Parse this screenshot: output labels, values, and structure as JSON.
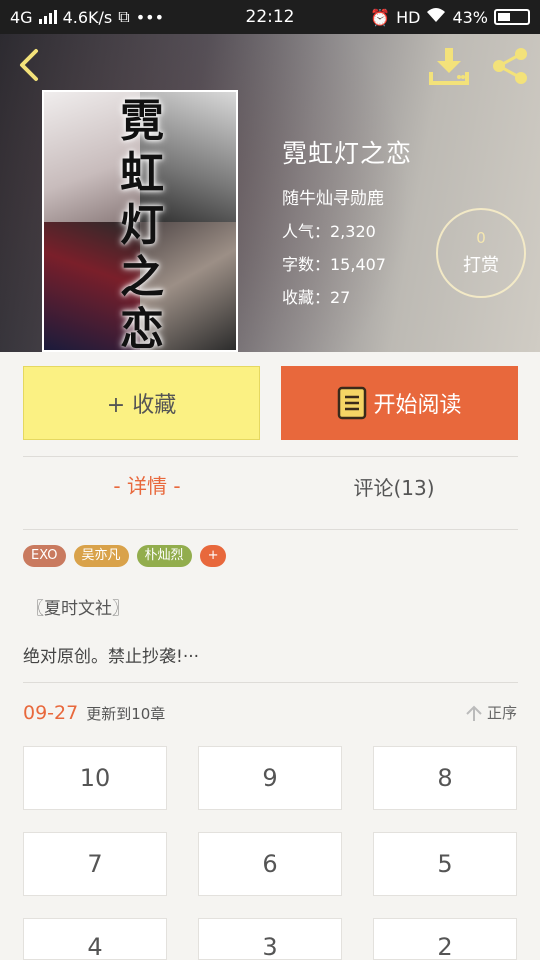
{
  "status_bar": {
    "network": "4G",
    "speed": "4.6K/s",
    "time": "22:12",
    "hd": "HD",
    "battery": "43%"
  },
  "book": {
    "title": "霓虹灯之恋",
    "cover_title": "霓虹灯之恋",
    "author": "随牛灿寻勋鹿",
    "popularity": "人气：2,320",
    "word_count": "字数：15,407",
    "favorites": "收藏：27",
    "tip_count": "0",
    "tip_label": "打赏"
  },
  "actions": {
    "favorite_label": "+ 收藏",
    "read_label": "开始阅读"
  },
  "tabs": {
    "detail": "- 详情 -",
    "comments": "评论(13)"
  },
  "tags": [
    {
      "label": "EXO",
      "color": "#c97a5f"
    },
    {
      "label": "吴亦凡",
      "color": "#d9a24a"
    },
    {
      "label": "朴灿烈",
      "color": "#92ad4d"
    },
    {
      "label": "+",
      "color": "#e8683c"
    }
  ],
  "description": {
    "line1": "〖夏时文社〗",
    "line2": "绝对原创。禁止抄袭!···"
  },
  "update": {
    "date": "09-27",
    "text": "更新到10章",
    "sort_label": "正序"
  },
  "chapters": [
    "10",
    "9",
    "8",
    "7",
    "6",
    "5",
    "4",
    "3",
    "2"
  ],
  "colors": {
    "accent": "#e8683c",
    "favorite_button": "#fbf183"
  }
}
